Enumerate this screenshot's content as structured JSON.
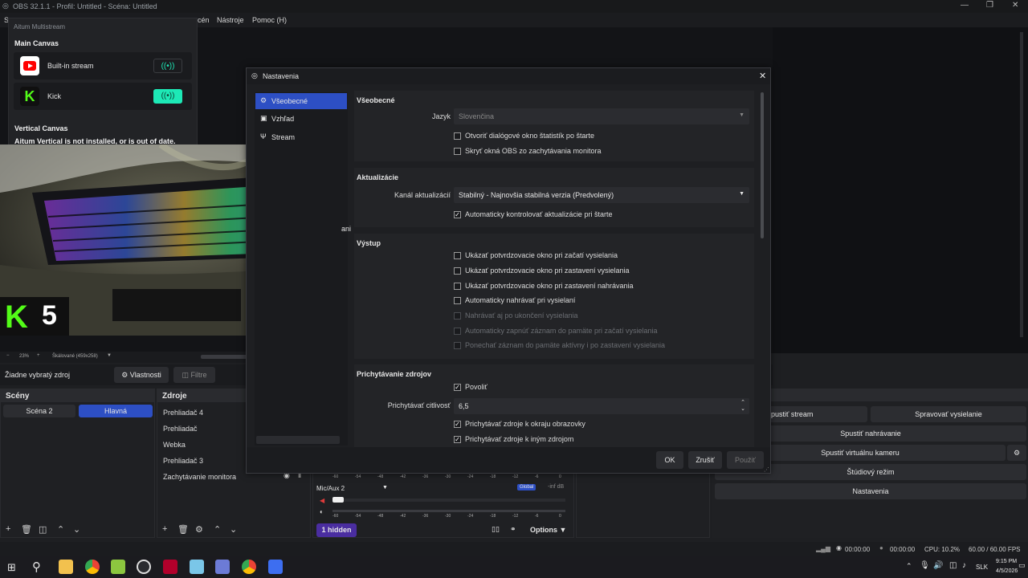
{
  "window": {
    "title": "OBS 32.1.1 - Profil: Untitled - Scéna: Untitled"
  },
  "menu": {
    "items": [
      "S",
      "cén",
      "Nástroje",
      "Pomoc (H)"
    ]
  },
  "aitum": {
    "title": "Aitum Multistream",
    "main_canvas": "Main Canvas",
    "streams": [
      {
        "name": "Built-in stream",
        "icon": "youtube-icon"
      },
      {
        "name": "Kick",
        "icon": "kick-icon"
      }
    ],
    "vertical_canvas": "Vertical Canvas",
    "vertical_warning": "Aitum Vertical is not installed, or is out of date."
  },
  "webcam": {
    "overlay_text": "5"
  },
  "preview_bar": {
    "zoom": "23%",
    "mode": "Škálované (459x258)"
  },
  "source_toolbar": {
    "no_source": "Žiadne vybratý zdroj",
    "properties": "Vlastnosti",
    "filters": "Filtre"
  },
  "scenes": {
    "title": "Scény",
    "items": [
      "Scéna 2",
      "Hlavná"
    ]
  },
  "sources": {
    "title": "Zdroje",
    "items": [
      "Prehliadač 4",
      "Prehliadač",
      "Webka",
      "Prehliadač 3",
      "Zachytávanie monitora"
    ]
  },
  "audio": {
    "device": "Mic/Aux 2",
    "global_badge": "Global",
    "level": "-inf dB",
    "scale": [
      "-60",
      "-54",
      "-48",
      "-42",
      "-36",
      "-30",
      "-24",
      "-18",
      "-12",
      "-6",
      "0"
    ],
    "hidden_label": "1 hidden",
    "options_label": "Options"
  },
  "controls": {
    "start_stream": "pustiť stream",
    "manage_stream": "Spravovať vysielanie",
    "start_recording": "Spustiť nahrávanie",
    "start_vcam": "Spustiť virtuálnu kameru",
    "studio_mode": "Štúdiový režim",
    "settings": "Nastavenia"
  },
  "status": {
    "stream_time": "00:00:00",
    "rec_time": "00:00:00",
    "cpu": "CPU: 10.2%",
    "fps": "60.00 / 60.00 FPS"
  },
  "taskbar": {
    "lang": "SLK",
    "time": "9:15 PM",
    "date": "4/5/2026"
  },
  "dialog": {
    "title": "Nastavenia",
    "nav": [
      {
        "label": "Všeobecné",
        "icon": "gear-icon"
      },
      {
        "label": "Vzhľad",
        "icon": "appearance-icon"
      },
      {
        "label": "Stream",
        "icon": "antenna-icon"
      }
    ],
    "nav_partial": "ani",
    "general": {
      "title": "Všeobecné",
      "language_label": "Jazyk",
      "language_value": "Slovenčina",
      "checks": [
        {
          "label": "Otvoriť dialógové okno štatistík po štarte",
          "checked": false
        },
        {
          "label": "Skryť okná OBS zo zachytávania monitora",
          "checked": false
        }
      ]
    },
    "updates": {
      "title": "Aktualizácie",
      "channel_label": "Kanál aktualizácií",
      "channel_value": "Stabilný - Najnovšia stabilná verzia (Predvolený)",
      "auto_check": "Automaticky kontrolovať aktualizácie pri štarte"
    },
    "output": {
      "title": "Výstup",
      "checks": [
        {
          "label": "Ukázať potvrdzovacie okno pri začatí vysielania",
          "disabled": false
        },
        {
          "label": "Ukázať potvrdzovacie okno pri zastavení vysielania",
          "disabled": false
        },
        {
          "label": "Ukázať potvrdzovacie okno pri zastavení nahrávania",
          "disabled": false
        },
        {
          "label": "Automaticky nahrávať pri vysielaní",
          "disabled": false
        },
        {
          "label": "Nahrávať aj po ukončení vysielania",
          "disabled": true
        },
        {
          "label": "Automaticky zapnúť záznam do pamäte pri začatí vysielania",
          "disabled": true
        },
        {
          "label": "Ponechať záznam do pamäte aktívny i po zastavení vysielania",
          "disabled": true
        }
      ]
    },
    "snapping": {
      "title": "Prichytávanie zdrojov",
      "enable": "Povoliť",
      "sensitivity_label": "Prichytávať citlivosť",
      "sensitivity_value": "6,5",
      "edge": "Prichytávať zdroje k okraju obrazovky",
      "other": "Prichytávať zdroje k iným zdrojom"
    },
    "buttons": {
      "ok": "OK",
      "cancel": "Zrušiť",
      "apply": "Použiť"
    }
  },
  "colors": {
    "accent": "#2d4fc4",
    "kick": "#53fc18",
    "youtube": "#ff0000",
    "toggle_active": "#1de9b6"
  }
}
